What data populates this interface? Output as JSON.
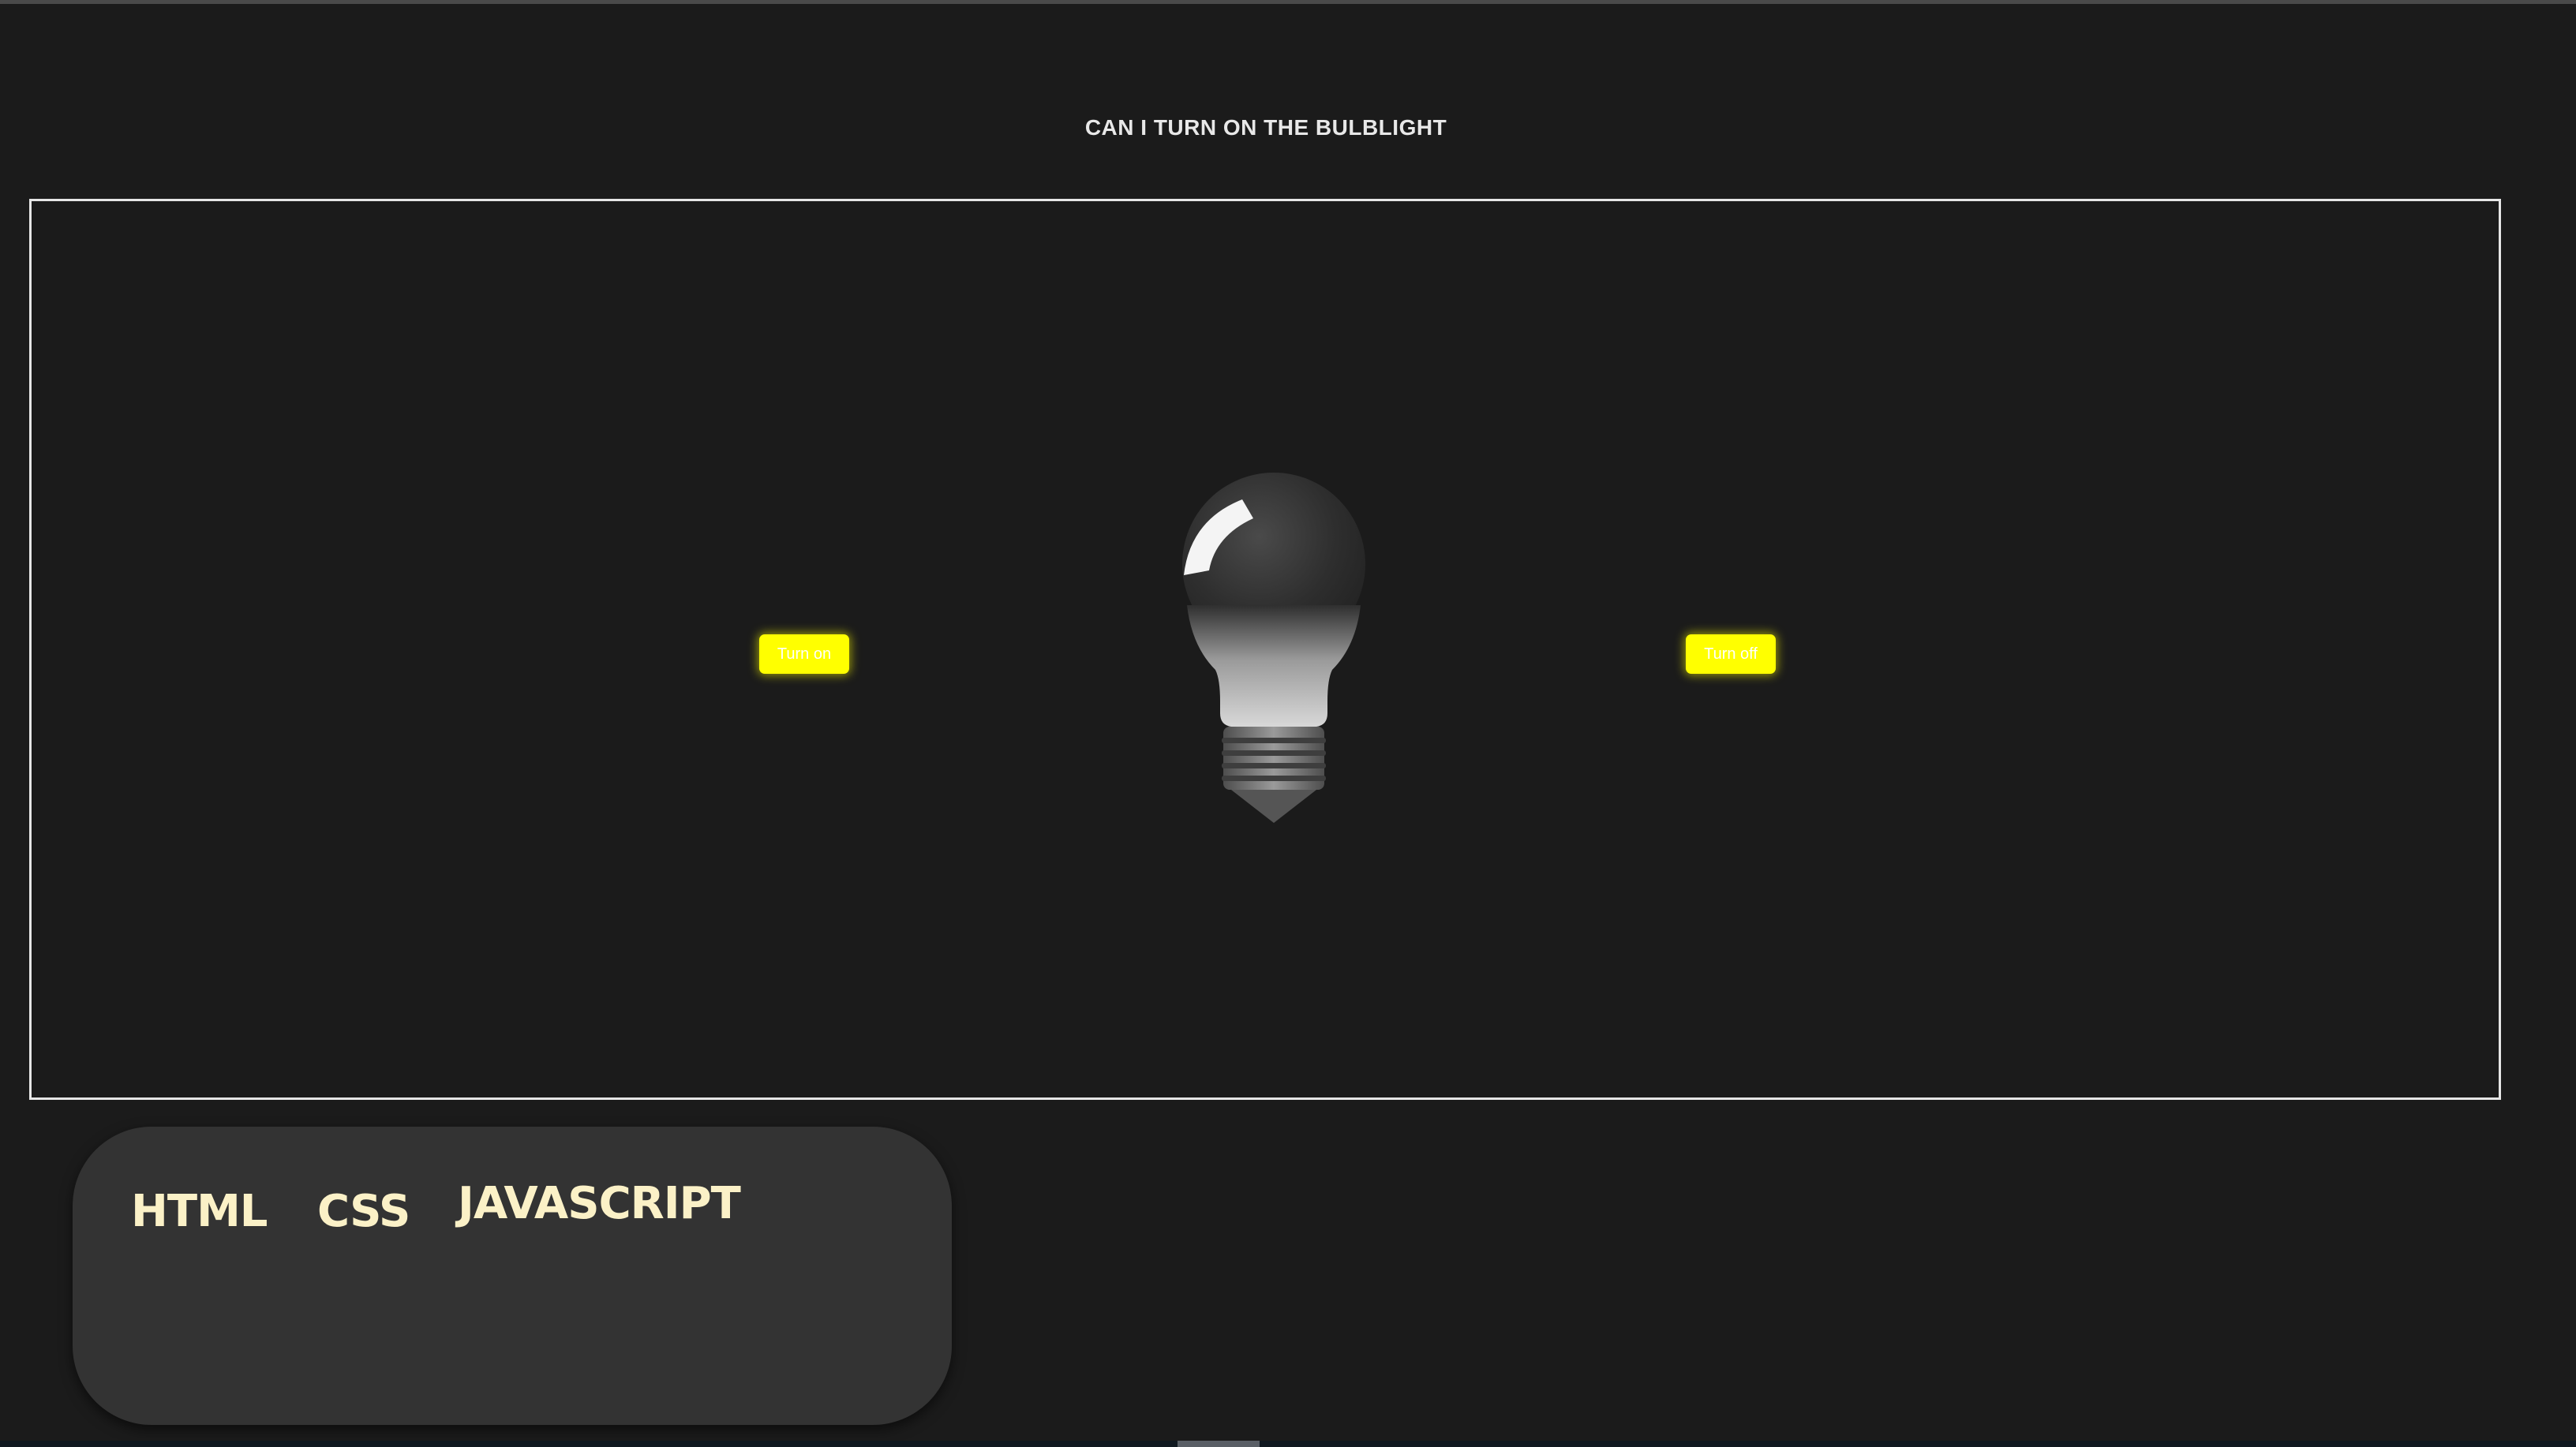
{
  "page": {
    "title": "CAN I TURN ON THE BULBLIGHT"
  },
  "controls": {
    "turn_on_label": "Turn on",
    "turn_off_label": "Turn off",
    "button_color": "#ffff00"
  },
  "bulb": {
    "state": "off",
    "icon": "lightbulb-icon"
  },
  "tech_stack": {
    "items": [
      "HTML",
      "CSS",
      "JAVASCRIPT"
    ],
    "text_color": "#fbf1c7"
  },
  "colors": {
    "background": "#1b1b1b",
    "card": "#333333",
    "border": "#e6e6e6"
  }
}
